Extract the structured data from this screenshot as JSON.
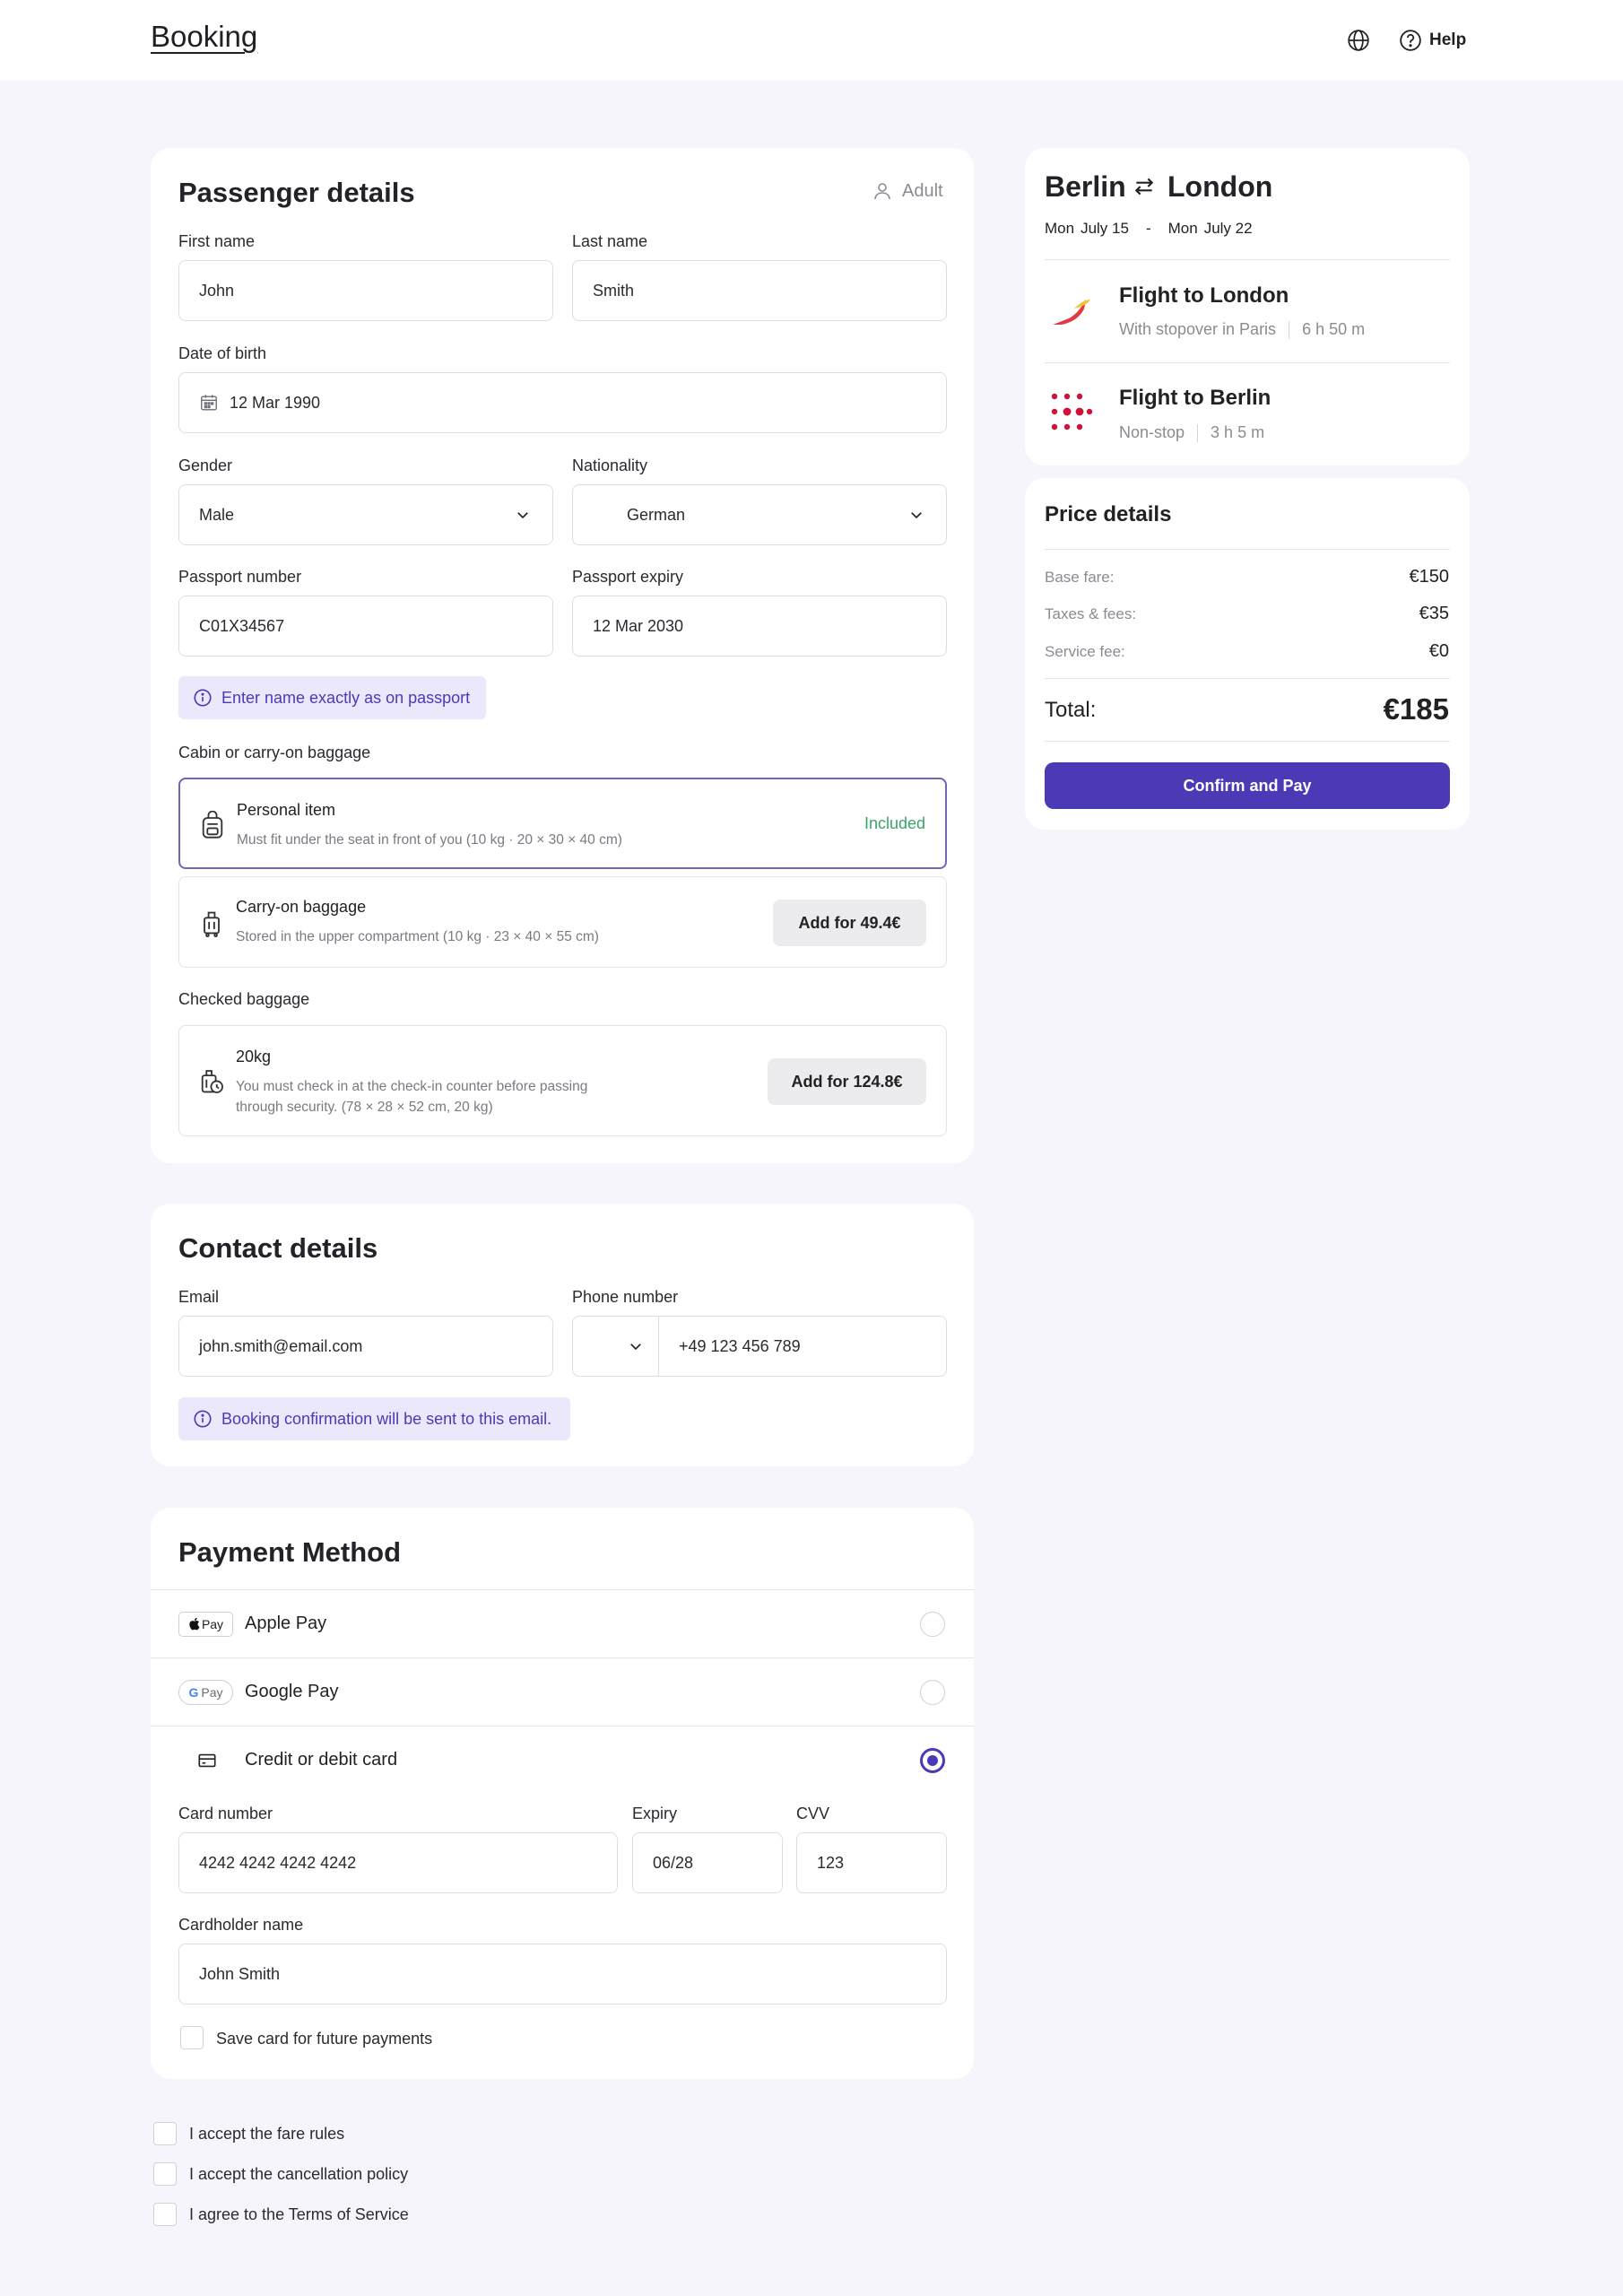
{
  "header": {
    "logo": "Booking",
    "help_label": "Help"
  },
  "passenger": {
    "title": "Passenger details",
    "type_label": "Adult",
    "first_name": {
      "label": "First name",
      "value": "John"
    },
    "last_name": {
      "label": "Last name",
      "value": "Smith"
    },
    "dob": {
      "label": "Date of birth",
      "value": "12 Mar 1990"
    },
    "gender": {
      "label": "Gender",
      "value": "Male"
    },
    "nationality": {
      "label": "Nationality",
      "value": "German"
    },
    "passport_number": {
      "label": "Passport number",
      "value": "C01X34567"
    },
    "passport_expiry": {
      "label": "Passport expiry",
      "value": "12 Mar 2030"
    },
    "info": "Enter name exactly as on passport",
    "cabin_label": "Cabin or carry-on baggage",
    "personal_item": {
      "title": "Personal item",
      "desc": "Must fit under the seat in front of you (10 kg · 20 × 30 × 40 cm)",
      "status": "Included"
    },
    "carry_on": {
      "title": "Carry-on baggage",
      "desc": "Stored in the upper compartment (10 kg · 23 × 40 × 55 cm)",
      "button": "Add for 49.4€"
    },
    "checked_label": "Checked baggage",
    "checked": {
      "title": "20kg",
      "desc_line1": "You must check in at the check-in counter before passing",
      "desc_line2": "through security. (78 × 28 × 52 cm, 20 kg)",
      "button": "Add for 124.8€"
    }
  },
  "contact": {
    "title": "Contact details",
    "email": {
      "label": "Email",
      "value": "john.smith@email.com"
    },
    "phone": {
      "label": "Phone number",
      "value": "+49 123 456 789"
    },
    "info": "Booking confirmation will be sent to this email."
  },
  "payment": {
    "title": "Payment Method",
    "methods": [
      {
        "badge": "Pay",
        "name": "Apple Pay",
        "selected": false
      },
      {
        "badge": "Pay",
        "name": "Google Pay",
        "selected": false
      },
      {
        "badge": "",
        "name": "Credit or debit card",
        "selected": true
      }
    ],
    "card_number": {
      "label": "Card number",
      "value": "4242 4242 4242 4242"
    },
    "expiry": {
      "label": "Expiry",
      "value": "06/28"
    },
    "cvv": {
      "label": "CVV",
      "value": "123"
    },
    "cardholder": {
      "label": "Cardholder name",
      "value": "John Smith"
    },
    "save_card": "Save card for future payments"
  },
  "agreements": [
    "I accept the fare rules",
    "I accept the cancellation policy",
    "I agree to the Terms of Service"
  ],
  "trip": {
    "from": "Berlin",
    "to": "London",
    "depart_day": "Mon",
    "depart_date": "July 15",
    "dash": "-",
    "return_day": "Mon",
    "return_date": "July 22",
    "flights": [
      {
        "title": "Flight to London",
        "stop": "With stopover in Paris",
        "duration": "6 h 50 m"
      },
      {
        "title": "Flight to Berlin",
        "stop": "Non-stop",
        "duration": "3 h 5 m"
      }
    ]
  },
  "price": {
    "title": "Price details",
    "rows": [
      {
        "label": "Base fare:",
        "value": "€150"
      },
      {
        "label": "Taxes & fees:",
        "value": "€35"
      },
      {
        "label": "Service fee:",
        "value": "€0"
      }
    ],
    "total_label": "Total:",
    "total_value": "€185",
    "confirm": "Confirm and Pay"
  },
  "colors": {
    "accent": "#4b3ab6",
    "info_bg": "#ebe8fb",
    "included": "#3aa56a",
    "page_bg": "#f6f5fb"
  }
}
